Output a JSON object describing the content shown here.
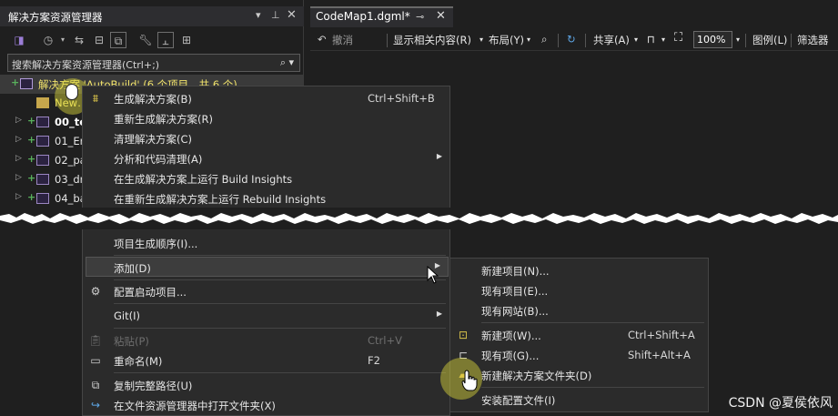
{
  "solution_explorer": {
    "title": "解决方案资源管理器",
    "search_placeholder": "搜索解决方案资源管理器(Ctrl+;)",
    "items": [
      {
        "label": "解决方案 'AutoBuild' (6 个项目，共 6 个)",
        "visible_label": "解决方案 'AutoBuild' (6 个项目，共 6 个)",
        "expander": "",
        "plus": "+"
      },
      {
        "label": "New…",
        "expander": "",
        "plus": ""
      },
      {
        "label": "00_te",
        "expander": "▷",
        "plus": "+"
      },
      {
        "label": "01_Er",
        "expander": "▷",
        "plus": "+"
      },
      {
        "label": "02_pa",
        "expander": "▷",
        "plus": "+"
      },
      {
        "label": "03_dr",
        "expander": "▷",
        "plus": "+"
      },
      {
        "label": "04_ba",
        "expander": "▷",
        "plus": "+"
      }
    ]
  },
  "editor_tab": {
    "title": "CodeMap1.dgml*",
    "pin": "⊸",
    "close": "✕"
  },
  "editor_toolbar": {
    "undo": "撤消",
    "show_related": "显示相关内容(R)",
    "layout": "布局(Y)",
    "share": "共享(A)",
    "zoom": "100%",
    "legend": "图例(L)",
    "filter": "筛选器"
  },
  "context_menu_top": [
    {
      "label": "生成解决方案(B)",
      "shortcut": "Ctrl+Shift+B",
      "icon": "build-icon"
    },
    {
      "label": "重新生成解决方案(R)",
      "shortcut": "",
      "icon": ""
    },
    {
      "label": "清理解决方案(C)",
      "shortcut": "",
      "icon": ""
    },
    {
      "label": "分析和代码清理(A)",
      "shortcut": "",
      "icon": "",
      "submenu": true
    },
    {
      "label": "在生成解决方案上运行 Build Insights",
      "shortcut": "",
      "icon": ""
    },
    {
      "label": "在重新生成解决方案上运行 Rebuild Insights",
      "shortcut": "",
      "icon": ""
    }
  ],
  "context_menu_bottom": [
    {
      "label": "项目生成顺序(I)...",
      "shortcut": ""
    },
    {
      "label": "添加(D)",
      "shortcut": "",
      "submenu": true,
      "highlighted": true
    },
    {
      "label": "配置启动项目...",
      "shortcut": "",
      "icon": "gear-icon"
    },
    {
      "label": "Git(I)",
      "shortcut": "",
      "submenu": true
    },
    {
      "label": "粘贴(P)",
      "shortcut": "Ctrl+V",
      "disabled": true,
      "icon": "paste-icon"
    },
    {
      "label": "重命名(M)",
      "shortcut": "F2",
      "icon": "rename-icon"
    },
    {
      "label": "复制完整路径(U)",
      "shortcut": "",
      "icon": "copy-icon"
    },
    {
      "label": "在文件资源管理器中打开文件夹(X)",
      "shortcut": "",
      "icon": "open-folder-icon"
    }
  ],
  "add_submenu": [
    {
      "label": "新建项目(N)...",
      "shortcut": ""
    },
    {
      "label": "现有项目(E)...",
      "shortcut": ""
    },
    {
      "label": "现有网站(B)...",
      "shortcut": ""
    },
    {
      "label": "新建项(W)...",
      "shortcut": "Ctrl+Shift+A",
      "icon": "new-item-icon"
    },
    {
      "label": "现有项(G)...",
      "shortcut": "Shift+Alt+A",
      "icon": "existing-item-icon"
    },
    {
      "label": "新建解决方案文件夹(D)",
      "shortcut": "",
      "icon": "new-folder-icon"
    },
    {
      "label": "安装配置文件(I)",
      "shortcut": ""
    }
  ],
  "watermark": "CSDN @夏侯依风",
  "colors": {
    "background": "#1f1f1f",
    "menu": "#2b2b2b",
    "highlight": "#3d3d3d",
    "accent_yellow": "#e1dc3c"
  }
}
